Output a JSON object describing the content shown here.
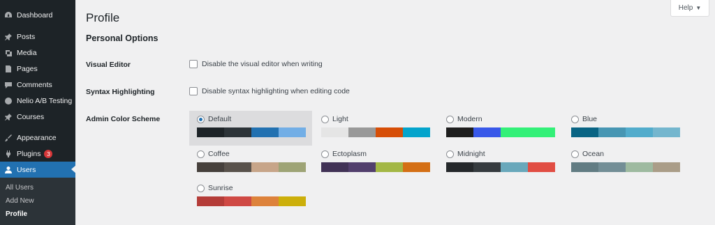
{
  "sidebar": {
    "items": [
      {
        "label": "Dashboard",
        "icon": "dashboard-icon"
      },
      {
        "label": "Posts",
        "icon": "pin-icon"
      },
      {
        "label": "Media",
        "icon": "media-icon"
      },
      {
        "label": "Pages",
        "icon": "pages-icon"
      },
      {
        "label": "Comments",
        "icon": "comment-icon"
      },
      {
        "label": "Nelio A/B Testing",
        "icon": "nelio-icon"
      },
      {
        "label": "Courses",
        "icon": "pin-icon"
      },
      {
        "label": "Appearance",
        "icon": "brush-icon"
      },
      {
        "label": "Plugins",
        "icon": "plugin-icon",
        "badge": "3"
      },
      {
        "label": "Users",
        "icon": "user-icon"
      }
    ],
    "submenu": [
      "All Users",
      "Add New",
      "Profile"
    ]
  },
  "header": {
    "title": "Profile",
    "help": "Help",
    "help_caret": "▼"
  },
  "personal_options": {
    "title": "Personal Options",
    "visual_editor": {
      "label": "Visual Editor",
      "checkbox": "Disable the visual editor when writing"
    },
    "syntax_highlighting": {
      "label": "Syntax Highlighting",
      "checkbox": "Disable syntax highlighting when editing code"
    },
    "color_scheme": {
      "label": "Admin Color Scheme",
      "selected": "Default",
      "schemes": [
        {
          "name": "Default",
          "colors": [
            "#1d2327",
            "#2c3338",
            "#2271b1",
            "#72aee6"
          ]
        },
        {
          "name": "Light",
          "colors": [
            "#e5e5e5",
            "#999999",
            "#d64e07",
            "#04a4cc"
          ]
        },
        {
          "name": "Modern",
          "colors": [
            "#1e1e1e",
            "#3858e9",
            "#33f078",
            "#33f078"
          ]
        },
        {
          "name": "Blue",
          "colors": [
            "#096484",
            "#4796b3",
            "#52accc",
            "#74b6ce"
          ]
        },
        {
          "name": "Coffee",
          "colors": [
            "#46403c",
            "#59524c",
            "#c7a589",
            "#9ea476"
          ]
        },
        {
          "name": "Ectoplasm",
          "colors": [
            "#413256",
            "#523f6d",
            "#a3b745",
            "#d46f15"
          ]
        },
        {
          "name": "Midnight",
          "colors": [
            "#25282b",
            "#363b3f",
            "#69a8bb",
            "#e14d43"
          ]
        },
        {
          "name": "Ocean",
          "colors": [
            "#627c83",
            "#738e96",
            "#9ebaa0",
            "#aa9d88"
          ]
        },
        {
          "name": "Sunrise",
          "colors": [
            "#b43c38",
            "#cf4944",
            "#dd823b",
            "#ccaf0b"
          ]
        }
      ]
    }
  }
}
